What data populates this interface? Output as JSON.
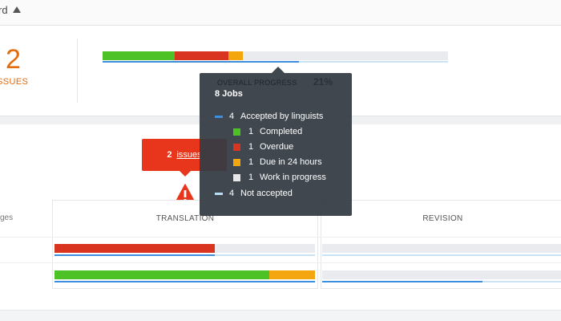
{
  "header": {
    "title": "rd"
  },
  "overview": {
    "issues_count": "2",
    "issues_label": "SSUES",
    "overall_bar": {
      "completed_fraction": 0.2088,
      "overdue_fraction": 0.1555,
      "due24_fraction": 0.0418,
      "remaining_fraction": 0.5939,
      "accepted_fraction": 0.5685
    }
  },
  "tooltip": {
    "progress_label": "OVERALL PROGRESS",
    "progress_pct": "21%",
    "jobs": "8 Jobs",
    "accepted_count": "4",
    "accepted_label": "Accepted by linguists",
    "completed_count": "1",
    "completed_label": "Completed",
    "overdue_count": "1",
    "overdue_label": "Overdue",
    "due24_count": "1",
    "due24_label": "Due in 24 hours",
    "wip_count": "1",
    "wip_label": "Work in progress",
    "not_accepted_count": "4",
    "not_accepted_label": "Not accepted"
  },
  "callout": {
    "count": "2",
    "link_label": "issues"
  },
  "table": {
    "row_label": "ges",
    "columns": [
      "TRANSLATION",
      "REVISION"
    ],
    "translation_rows": [
      {
        "completed_fraction": 0,
        "overdue_fraction": 0.615,
        "due24_fraction": 0,
        "accepted_fraction": 0.615
      },
      {
        "completed_fraction": 0.825,
        "overdue_fraction": 0,
        "due24_fraction": 0.175,
        "accepted_fraction": 1.0
      }
    ],
    "revision_rows": [
      {
        "completed_fraction": 0,
        "overdue_fraction": 0,
        "due24_fraction": 0,
        "accepted_fraction": 0
      },
      {
        "completed_fraction": 0,
        "overdue_fraction": 0,
        "due24_fraction": 0,
        "accepted_fraction": 0.667
      }
    ]
  },
  "colors": {
    "completed": "#4dc227",
    "overdue": "#d8341f",
    "due24": "#f3a60d",
    "remaining": "#e9ebee",
    "accepted_line": "#3d8ede",
    "issue_accent": "#e36b0a",
    "callout_bg": "#e8361c"
  },
  "icons": {
    "header_caret": "caret-up-icon",
    "warning": "warning-icon"
  }
}
